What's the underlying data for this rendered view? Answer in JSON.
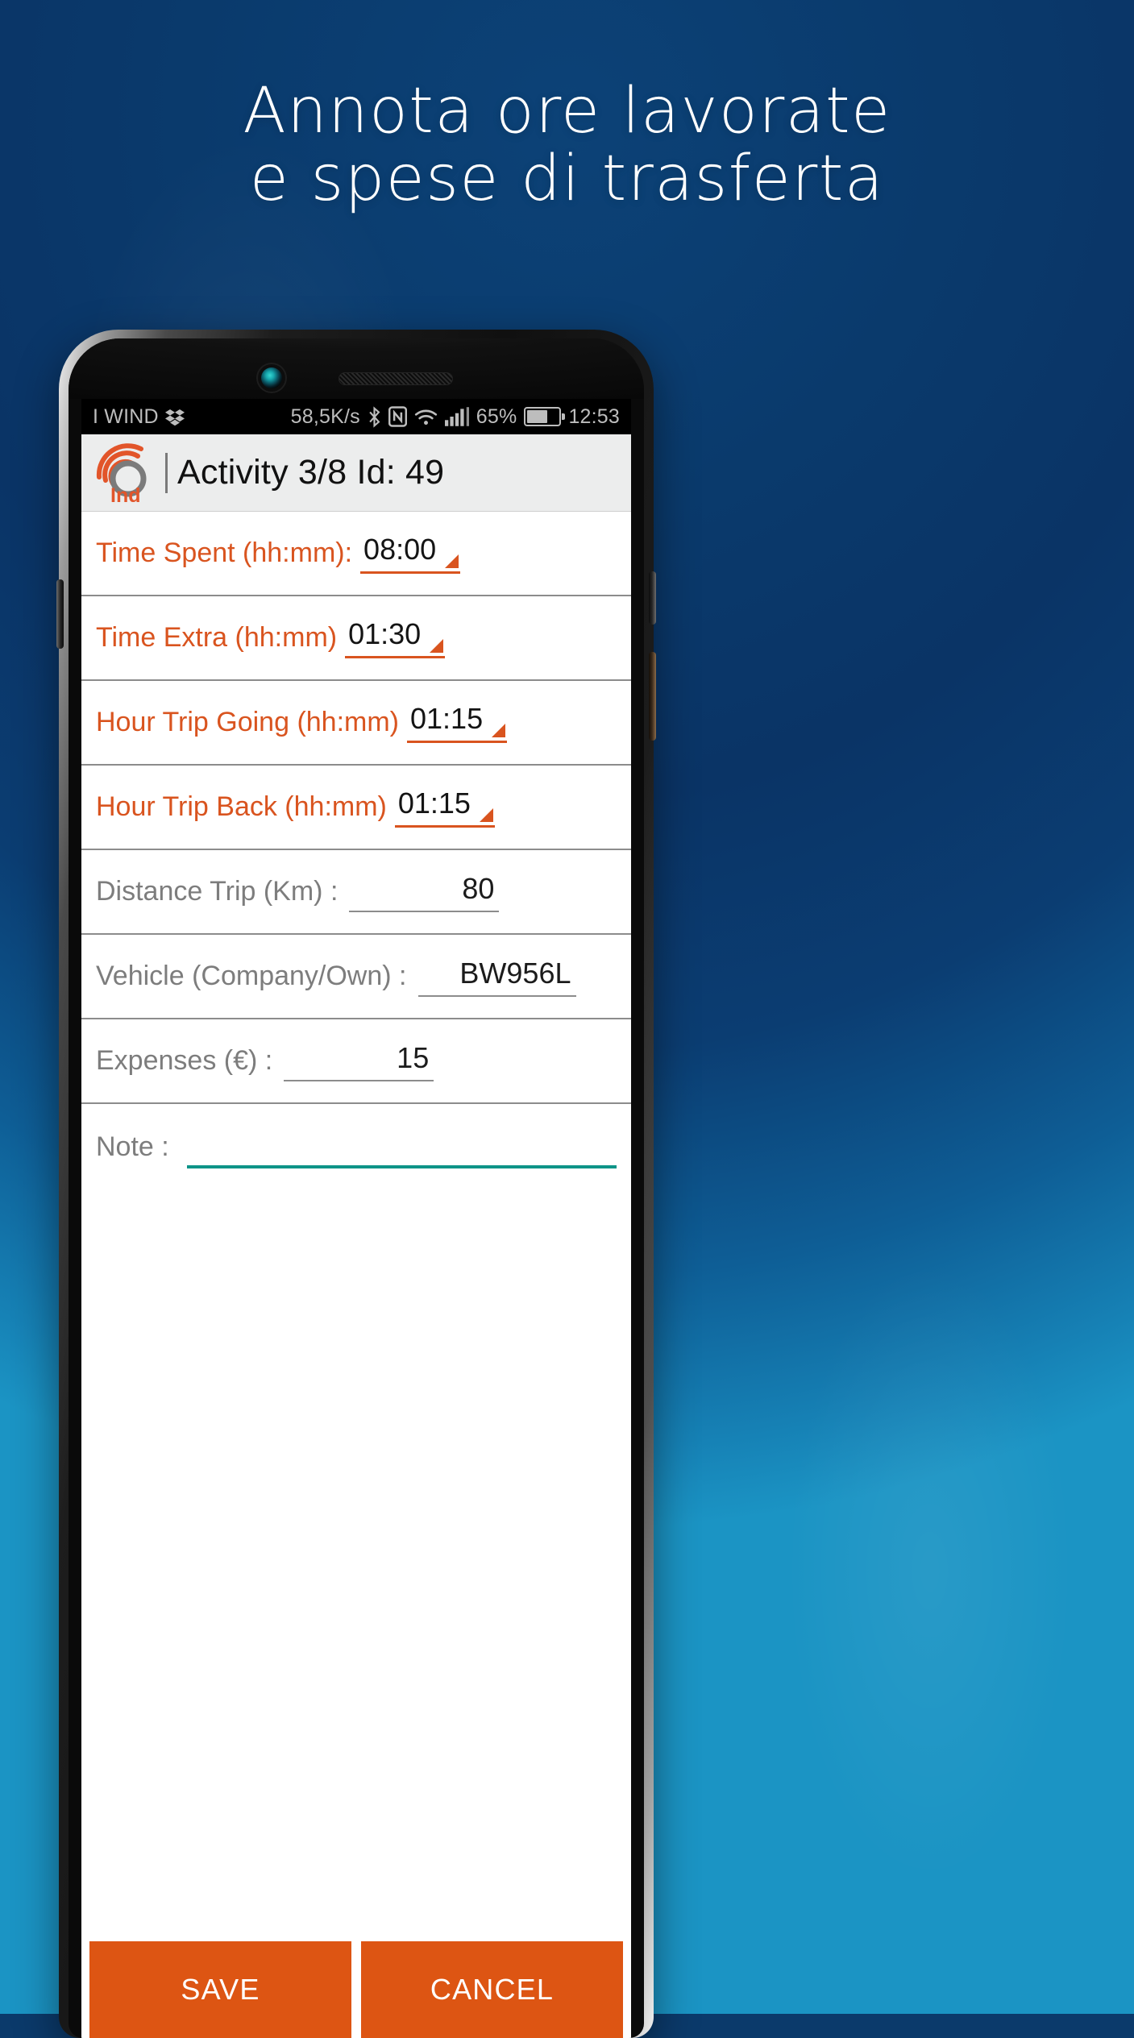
{
  "promo": {
    "headline_line1": "Annota ore lavorate",
    "headline_line2": "e spese di trasferta",
    "background_top_color": "#0a3a6b",
    "background_bottom_color": "#1a8fbf",
    "headline_color": "#ffffff"
  },
  "statusbar": {
    "carrier": "I WIND",
    "dropbox_icon": "dropbox-icon",
    "network_speed": "58,5K/s",
    "bluetooth_icon": "bluetooth-icon",
    "nfc_icon": "nfc-icon",
    "wifi_icon": "wifi-icon",
    "signal_icon": "cellular-signal-icon",
    "battery_percent": "65%",
    "battery_icon": "battery-icon",
    "clock": "12:53"
  },
  "appbar": {
    "logo_icon": "app-logo-icon",
    "logo_text": "Ind",
    "title": "Activity 3/8 Id: 49",
    "background": "#eceded",
    "accent": "#d9541f"
  },
  "form": {
    "rows": [
      {
        "label": "Time Spent (hh:mm):",
        "value": "08:00",
        "control": "spinner",
        "label_color": "#d9541f"
      },
      {
        "label": "Time Extra (hh:mm)",
        "value": "01:30",
        "control": "spinner",
        "label_color": "#d9541f"
      },
      {
        "label": "Hour Trip Going (hh:mm)",
        "value": "01:15",
        "control": "spinner",
        "label_color": "#d9541f"
      },
      {
        "label": "Hour Trip Back (hh:mm)",
        "value": "01:15",
        "control": "spinner",
        "label_color": "#d9541f"
      },
      {
        "label": "Distance Trip (Km) :",
        "value": "80",
        "control": "text",
        "label_color": "#7d7d7d"
      },
      {
        "label": "Vehicle (Company/Own) :",
        "value": "BW956L",
        "control": "text",
        "label_color": "#7d7d7d"
      },
      {
        "label": "Expenses (€) :",
        "value": "15",
        "control": "text",
        "label_color": "#7d7d7d"
      }
    ],
    "note": {
      "label": "Note :",
      "value": "",
      "placeholder": "",
      "focus_color": "#0d9488"
    }
  },
  "buttons": {
    "save_label": "SAVE",
    "cancel_label": "CANCEL",
    "color": "#dd5513"
  }
}
